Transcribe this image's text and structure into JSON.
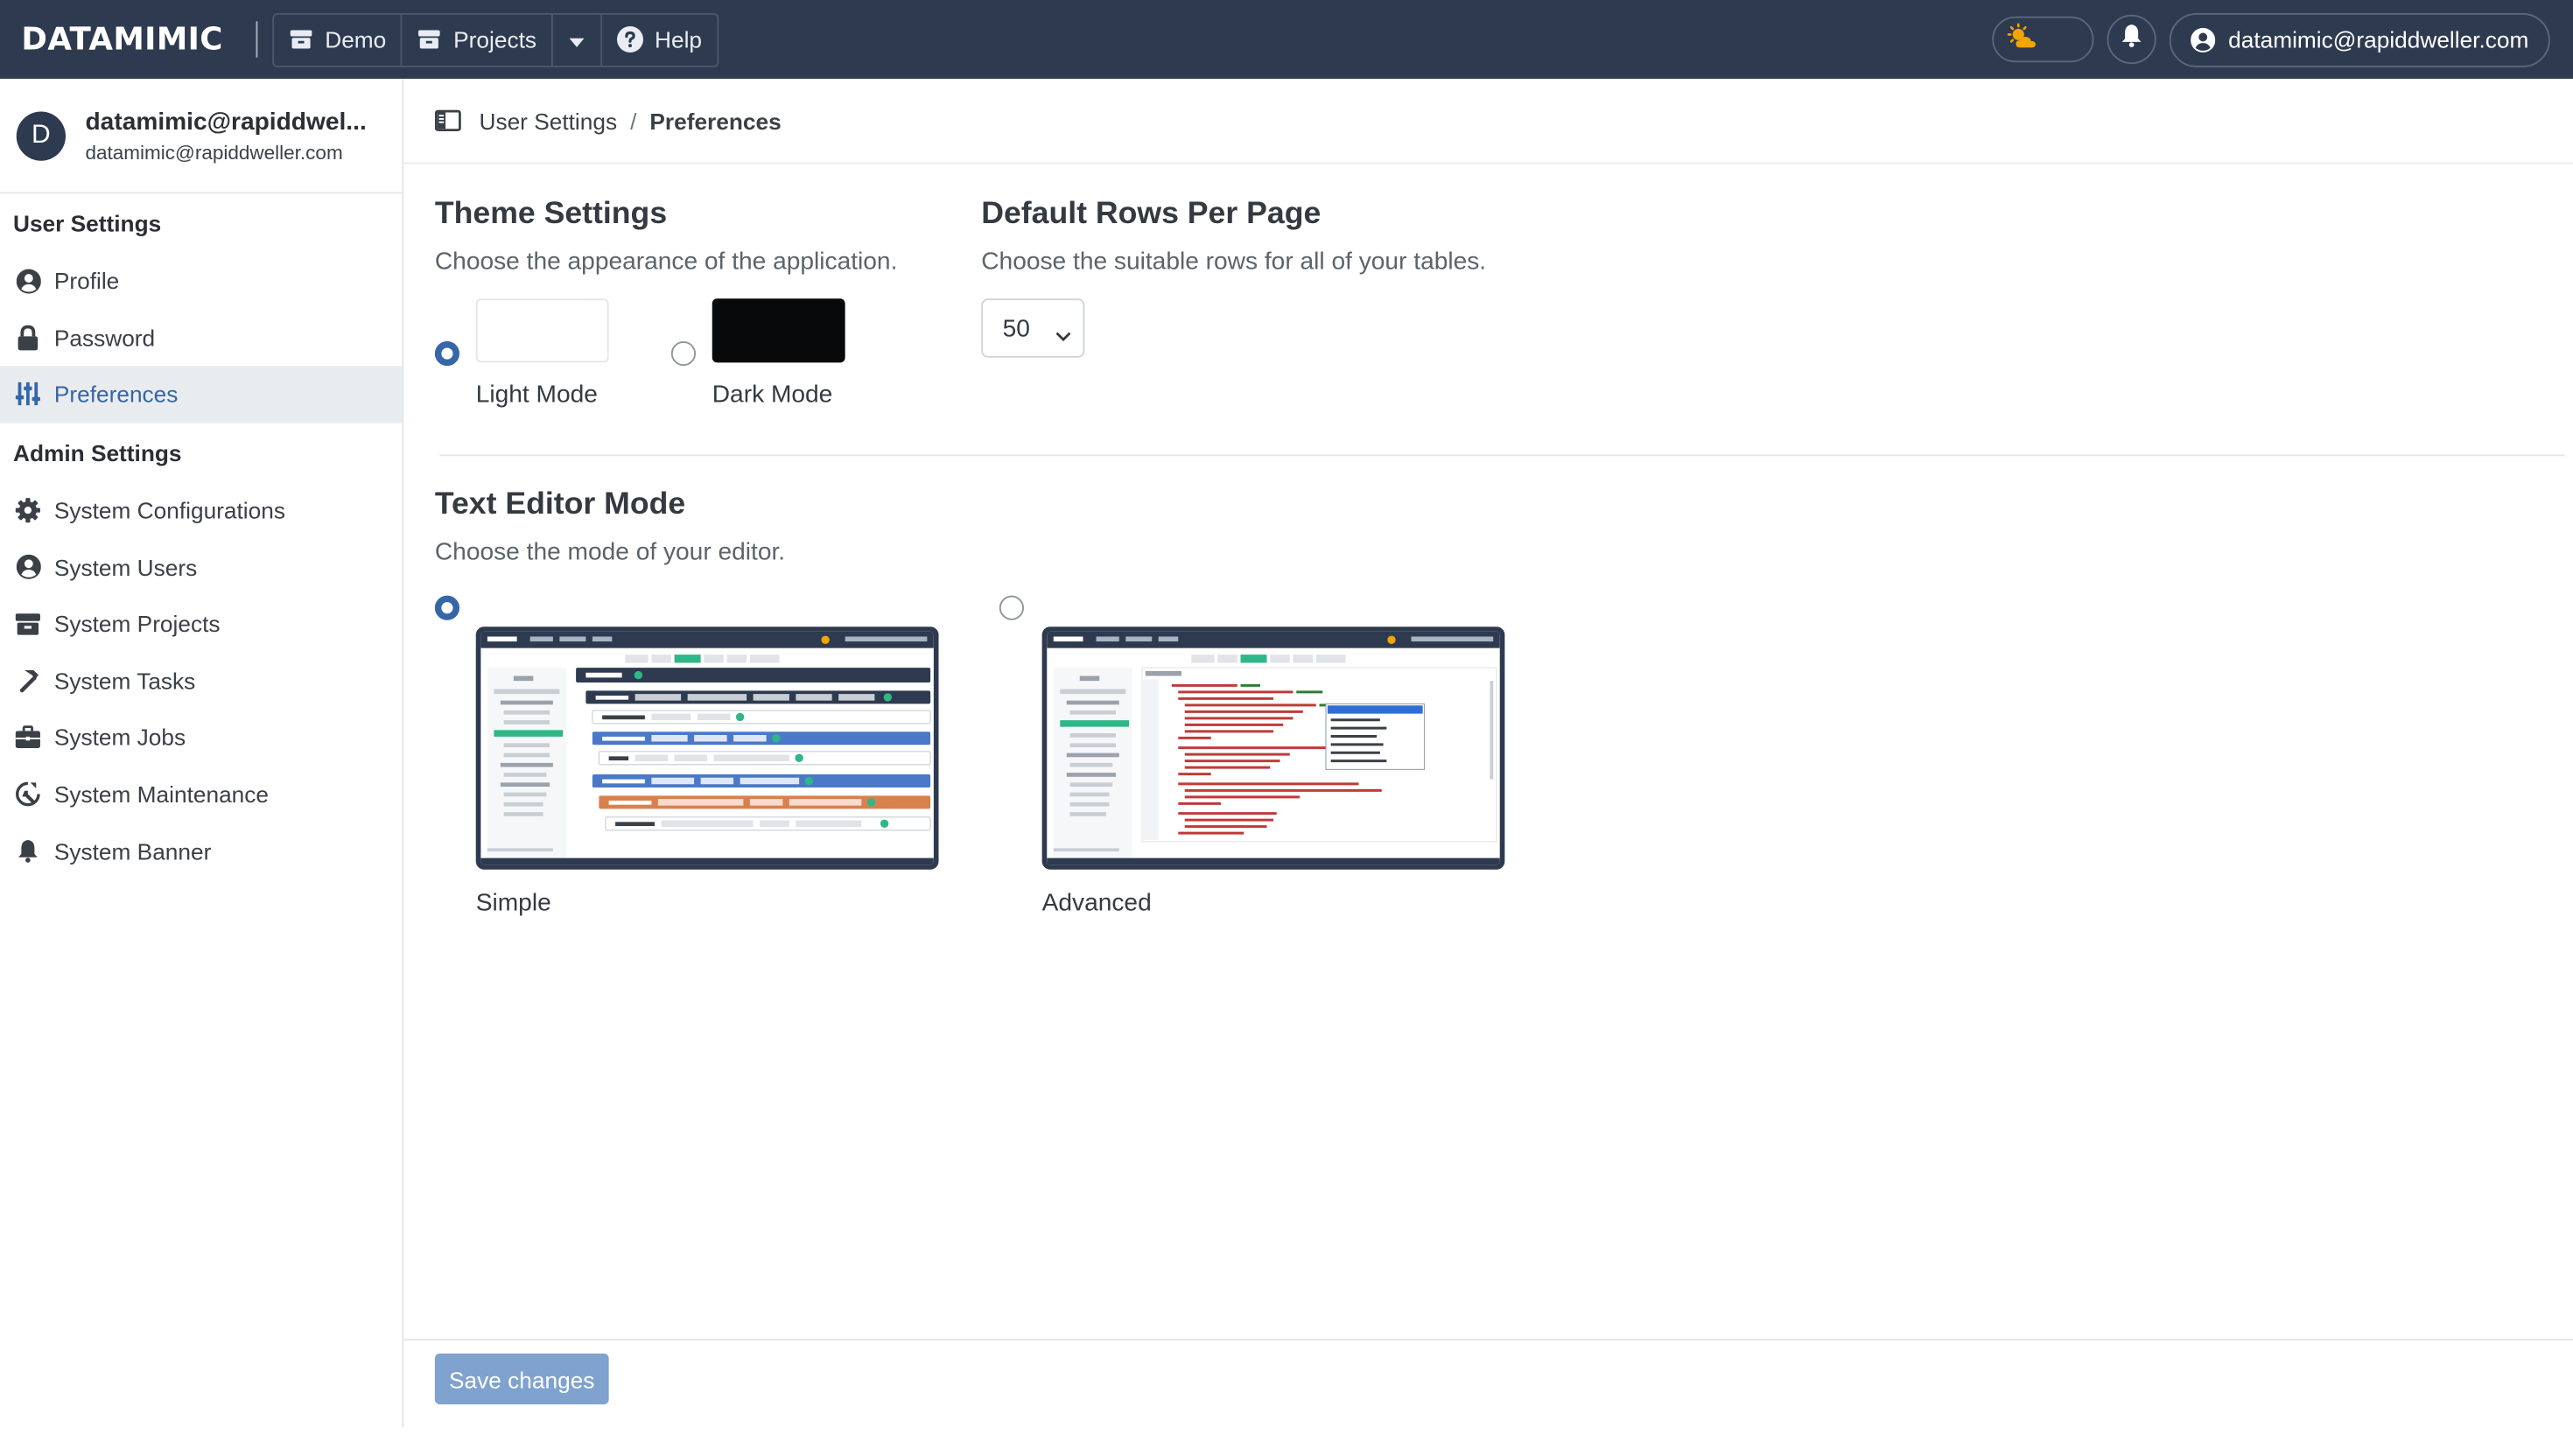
{
  "app": {
    "brand": "DATAMIMIC"
  },
  "nav": {
    "demo_label": "Demo",
    "projects_label": "Projects",
    "help_label": "Help",
    "user_label": "datamimic@rapiddweller.com"
  },
  "profile": {
    "avatar_letter": "D",
    "name": "datamimic@rapiddwel...",
    "email": "datamimic@rapiddweller.com"
  },
  "sidebar": {
    "user_settings_title": "User Settings",
    "user_items": [
      {
        "label": "Profile",
        "icon": "user-circle-icon"
      },
      {
        "label": "Password",
        "icon": "lock-icon"
      },
      {
        "label": "Preferences",
        "icon": "sliders-icon",
        "active": true
      }
    ],
    "admin_settings_title": "Admin Settings",
    "admin_items": [
      {
        "label": "System Configurations",
        "icon": "gear-icon"
      },
      {
        "label": "System Users",
        "icon": "user-circle-icon"
      },
      {
        "label": "System Projects",
        "icon": "archive-icon"
      },
      {
        "label": "System Tasks",
        "icon": "hammer-icon"
      },
      {
        "label": "System Jobs",
        "icon": "briefcase-icon"
      },
      {
        "label": "System Maintenance",
        "icon": "maintenance-icon"
      },
      {
        "label": "System Banner",
        "icon": "bell-icon"
      }
    ]
  },
  "breadcrumb": {
    "parent": "User Settings",
    "separator": "/",
    "current": "Preferences"
  },
  "theme": {
    "title": "Theme Settings",
    "description": "Choose the appearance of the application.",
    "light_label": "Light Mode",
    "dark_label": "Dark Mode",
    "selected": "light"
  },
  "rows": {
    "title": "Default Rows Per Page",
    "description": "Choose the suitable rows for all of your tables.",
    "value": "50"
  },
  "editor": {
    "title": "Text Editor Mode",
    "description": "Choose the mode of your editor.",
    "simple_label": "Simple",
    "advanced_label": "Advanced",
    "selected": "simple"
  },
  "footer": {
    "save_label": "Save changes"
  },
  "colors": {
    "navbar": "#2e3a4f",
    "accent": "#3566a8",
    "save_button": "#7fa2cf",
    "active_bg": "#e9ecef"
  }
}
